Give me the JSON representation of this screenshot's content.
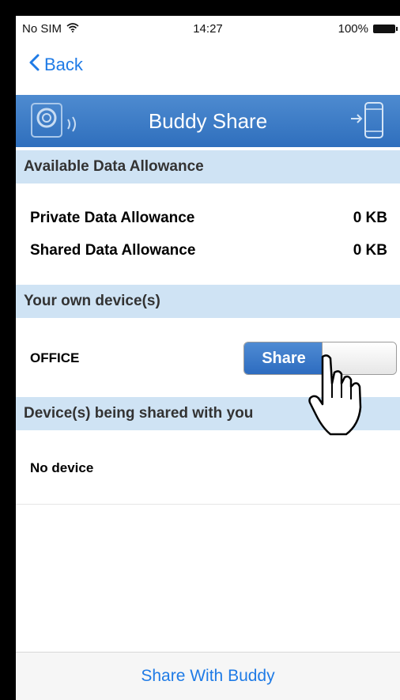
{
  "status": {
    "carrier": "No SIM",
    "time": "14:27",
    "battery": "100%"
  },
  "nav": {
    "back_label": "Back"
  },
  "header": {
    "title": "Buddy Share"
  },
  "sections": {
    "allowance": "Available Data Allowance",
    "own_devices": "Your own device(s)",
    "shared_devices": "Device(s) being shared with you"
  },
  "allowance": {
    "private_label": "Private Data Allowance",
    "private_value": "0 KB",
    "shared_label": "Shared Data Allowance",
    "shared_value": "0 KB"
  },
  "own_device": {
    "name": "OFFICE",
    "toggle_label": "Share"
  },
  "shared_device": {
    "text": "No device"
  },
  "bottom": {
    "share_with_buddy": "Share With Buddy"
  },
  "colors": {
    "accent": "#1f7be6",
    "header_blue": "#3a77c6",
    "section_bg": "#cfe3f4"
  },
  "icons": [
    "wifi-icon",
    "battery-icon",
    "chevron-left-icon",
    "camera-icon",
    "phone-transfer-icon",
    "hand-cursor-icon"
  ]
}
